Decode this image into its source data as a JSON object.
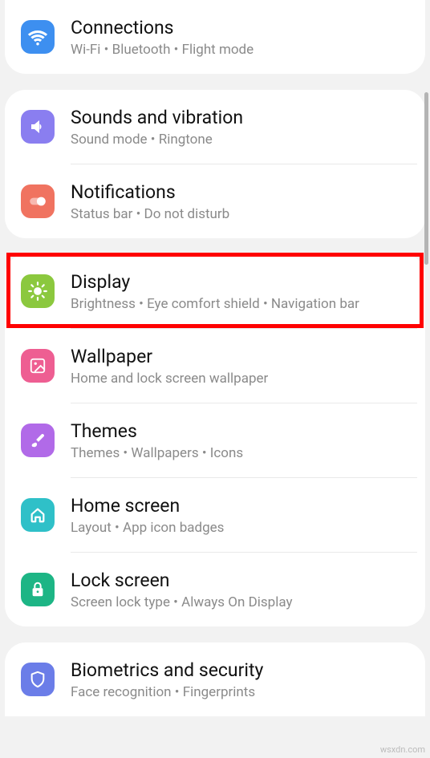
{
  "groups": [
    {
      "items": [
        {
          "id": "connections",
          "icon": "wifi",
          "color": "#3d8ff0",
          "title": "Connections",
          "subtitle": "Wi-Fi  •  Bluetooth  •  Flight mode"
        }
      ]
    },
    {
      "items": [
        {
          "id": "sounds",
          "icon": "speaker",
          "color": "#8a7ef0",
          "title": "Sounds and vibration",
          "subtitle": "Sound mode  •  Ringtone"
        },
        {
          "id": "notifications",
          "icon": "toggle",
          "color": "#f07360",
          "title": "Notifications",
          "subtitle": "Status bar  •  Do not disturb"
        }
      ]
    },
    {
      "items": [
        {
          "id": "display",
          "icon": "sun",
          "color": "#8bc83e",
          "title": "Display",
          "subtitle": "Brightness  •  Eye comfort shield  •  Navigation bar",
          "highlighted": true
        },
        {
          "id": "wallpaper",
          "icon": "image",
          "color": "#ee5e92",
          "title": "Wallpaper",
          "subtitle": "Home and lock screen wallpaper"
        },
        {
          "id": "themes",
          "icon": "brush",
          "color": "#b16ae8",
          "title": "Themes",
          "subtitle": "Themes  •  Wallpapers  •  Icons"
        },
        {
          "id": "home-screen",
          "icon": "home",
          "color": "#2fc0c8",
          "title": "Home screen",
          "subtitle": "Layout  •  App icon badges"
        },
        {
          "id": "lock-screen",
          "icon": "lock",
          "color": "#1db585",
          "title": "Lock screen",
          "subtitle": "Screen lock type  •  Always On Display"
        }
      ]
    },
    {
      "items": [
        {
          "id": "biometrics",
          "icon": "shield",
          "color": "#6b7de8",
          "title": "Biometrics and security",
          "subtitle": "Face recognition  •  Fingerprints"
        }
      ]
    }
  ],
  "watermark": "wsxdn.com"
}
